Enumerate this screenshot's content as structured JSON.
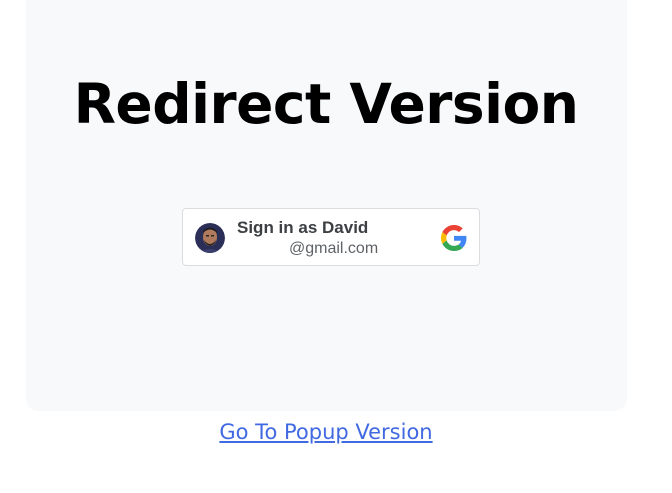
{
  "page": {
    "title": "Redirect Version"
  },
  "google_signin": {
    "label": "Sign in as David",
    "email": "@gmail.com",
    "avatar_icon": "user-avatar",
    "brand_icon": "google-g-logo",
    "brand_colors": {
      "blue": "#4285F4",
      "red": "#EA4335",
      "yellow": "#FBBC05",
      "green": "#34A853"
    }
  },
  "footer": {
    "link_label": "Go To Popup Version",
    "link_color": "#4169e1"
  }
}
